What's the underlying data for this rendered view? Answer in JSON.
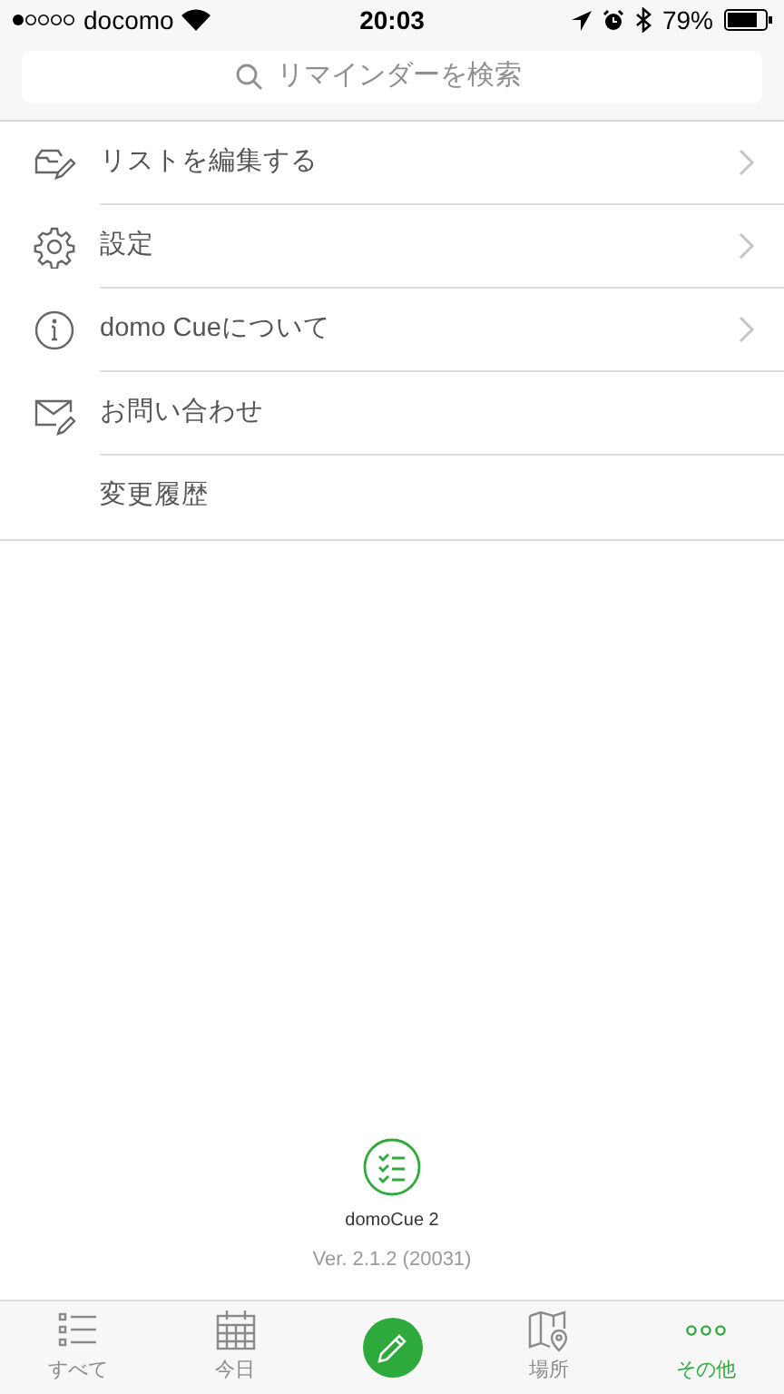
{
  "status_bar": {
    "carrier": "docomo",
    "time": "20:03",
    "battery": "79%"
  },
  "search": {
    "placeholder": "リマインダーを検索"
  },
  "menu": [
    {
      "kind": "edit",
      "label": "リストを編集する",
      "chevron": true
    },
    {
      "kind": "settings",
      "label": "設定",
      "chevron": true
    },
    {
      "kind": "info",
      "label": "domo Cueについて",
      "chevron": true
    },
    {
      "kind": "mail",
      "label": "お問い合わせ",
      "chevron": false
    },
    {
      "kind": "plain",
      "label": "変更履歴",
      "chevron": false
    }
  ],
  "app_info": {
    "name": "domoCue 2",
    "version": "Ver. 2.1.2 (20031)"
  },
  "tab_bar": [
    {
      "kind": "list",
      "label": "すべて",
      "selected": false
    },
    {
      "kind": "calendar",
      "label": "今日",
      "selected": false
    },
    {
      "kind": "compose"
    },
    {
      "kind": "map",
      "label": "場所",
      "selected": false
    },
    {
      "kind": "more",
      "label": "その他",
      "selected": true
    }
  ]
}
